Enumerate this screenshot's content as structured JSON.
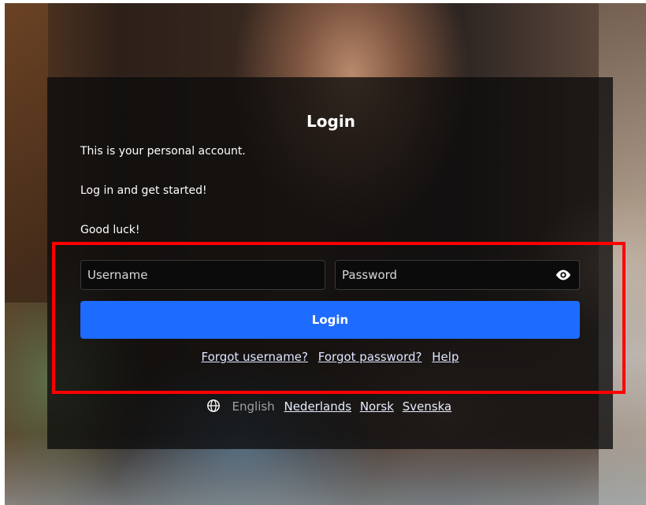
{
  "login": {
    "title": "Login",
    "intro_line1": "This is your personal account.",
    "intro_line2": "Log in and get started!",
    "intro_line3": "Good luck!",
    "username_placeholder": "Username",
    "password_placeholder": "Password",
    "login_button": "Login"
  },
  "help_links": {
    "forgot_username": "Forgot username?",
    "forgot_password": "Forgot password?",
    "help": "Help"
  },
  "languages": {
    "current": "English",
    "options": [
      "Nederlands",
      "Norsk",
      "Svenska"
    ]
  },
  "icons": {
    "password_toggle": "eye-icon",
    "language": "globe-icon"
  },
  "colors": {
    "accent": "#1e6bff",
    "panel": "#0c0c0c",
    "highlight": "#ff0000"
  }
}
